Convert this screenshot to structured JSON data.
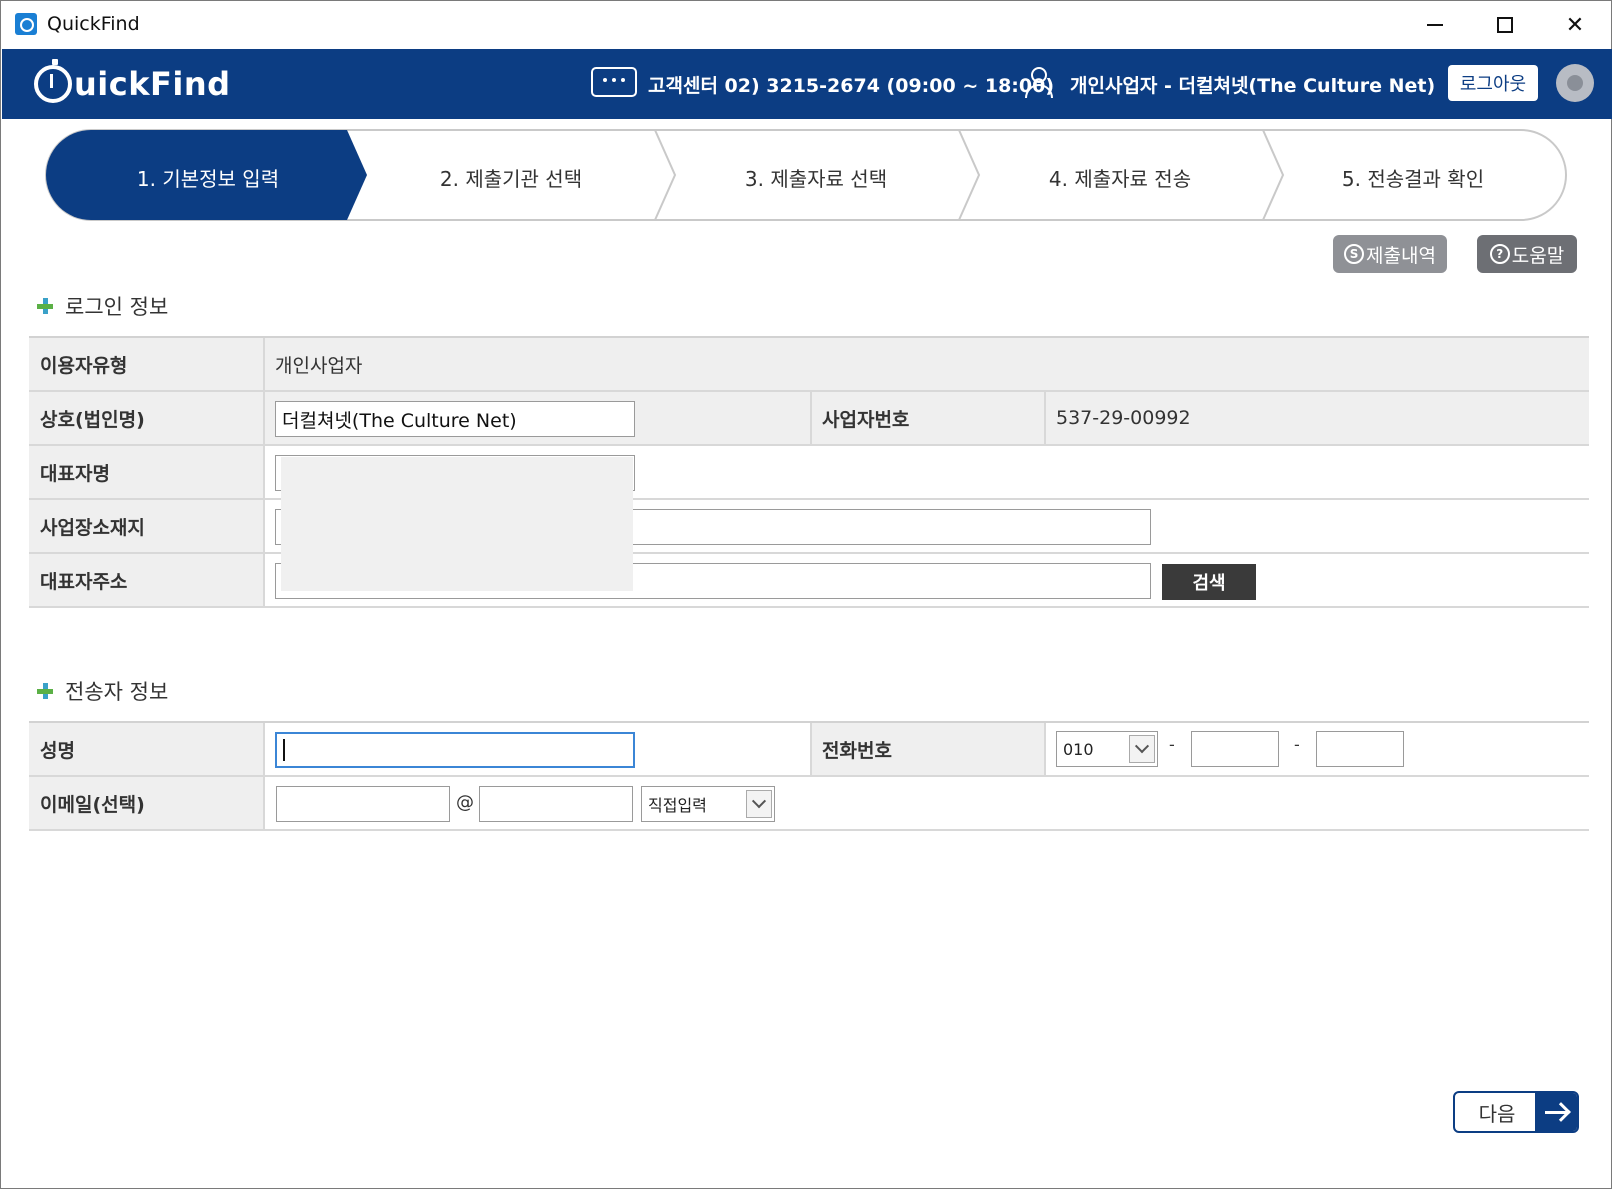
{
  "window": {
    "title": "QuickFind"
  },
  "header": {
    "logo": "uickFind",
    "customer_center": "고객센터 02) 3215-2674 (09:00 ~ 18:00)",
    "user_info": "개인사업자 - 더컬쳐넷(The Culture Net)",
    "logout_label": "로그아웃"
  },
  "steps": [
    {
      "label": "1. 기본정보 입력",
      "active": true
    },
    {
      "label": "2. 제출기관 선택",
      "active": false
    },
    {
      "label": "3. 제출자료 선택",
      "active": false
    },
    {
      "label": "4. 제출자료 전송",
      "active": false
    },
    {
      "label": "5. 전송결과 확인",
      "active": false
    }
  ],
  "actions": {
    "history_label": "제출내역",
    "history_icon": "S",
    "help_label": "도움말",
    "help_icon": "?"
  },
  "login_section": {
    "title": "로그인 정보",
    "user_type_label": "이용자유형",
    "user_type_value": "개인사업자",
    "company_label": "상호(법인명)",
    "company_value": "더컬쳐넷(The Culture Net)",
    "biz_no_label": "사업자번호",
    "biz_no_value": "537-29-00992",
    "ceo_label": "대표자명",
    "biz_address_label": "사업장소재지",
    "ceo_address_label": "대표자주소",
    "search_label": "검색"
  },
  "sender_section": {
    "title": "전송자 정보",
    "name_label": "성명",
    "phone_label": "전화번호",
    "phone_prefix": "010",
    "phone_sep": "-",
    "email_label": "이메일(선택)",
    "email_at": "@",
    "email_domain_option": "직접입력"
  },
  "next_label": "다음",
  "colors": {
    "brand": "#0c3d83",
    "gray_button": "#8f9196",
    "dark_button": "#3a3a3a"
  }
}
